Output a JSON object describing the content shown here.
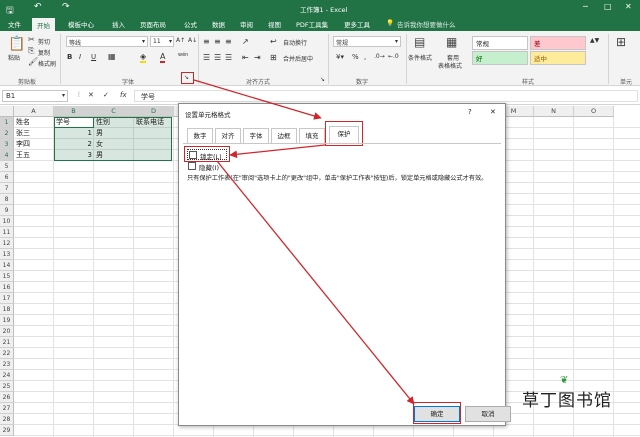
{
  "titlebar": {
    "title": "工作簿1 - Excel",
    "search": "告诉我你想要做什么"
  },
  "tabs": [
    "文件",
    "开始",
    "模板中心",
    "插入",
    "页面布局",
    "公式",
    "数据",
    "审阅",
    "视图",
    "PDF工具集",
    "更多工具"
  ],
  "ribbon": {
    "paste": "粘贴",
    "cut": "剪切",
    "copy": "复制",
    "format_painter": "格式刷",
    "clipboard": "剪贴板",
    "font_name": "等线",
    "font_size": "11",
    "bold": "B",
    "italic": "I",
    "underline": "U",
    "wen": "wén",
    "font_group": "字体",
    "wrap_text": "自动换行",
    "merge_center": "合并后居中",
    "align_group": "对齐方式",
    "number_format": "常规",
    "number_group": "数字",
    "cond_format": "条件格式",
    "table_format_1": "套用",
    "table_format_2": "表格格式",
    "style_normal": "常规",
    "style_bad": "差",
    "style_good": "好",
    "style_neutral": "适中",
    "style_group": "样式",
    "cell_group": "单元"
  },
  "formula_bar": {
    "name_box": "B1",
    "x": "✕",
    "check": "✓",
    "fx": "fx",
    "value": "学号"
  },
  "columns": [
    "A",
    "B",
    "C",
    "D",
    "E",
    "F",
    "G",
    "H",
    "I",
    "J",
    "K",
    "L",
    "M",
    "N",
    "O"
  ],
  "rows": [
    "1",
    "2",
    "3",
    "4",
    "5",
    "6",
    "7",
    "8",
    "9",
    "10",
    "11",
    "12",
    "13",
    "14",
    "15",
    "16",
    "17",
    "18",
    "19",
    "20",
    "21",
    "22",
    "23",
    "24",
    "25",
    "26",
    "27",
    "28",
    "29"
  ],
  "cells": [
    [
      "姓名",
      "学号",
      "性别",
      "联系电话"
    ],
    [
      "张三",
      "1",
      "男",
      ""
    ],
    [
      "李四",
      "2",
      "女",
      ""
    ],
    [
      "王五",
      "3",
      "男",
      ""
    ]
  ],
  "dialog": {
    "title": "设置单元格格式",
    "help": "?",
    "close": "✕",
    "tabs": [
      "数字",
      "对齐",
      "字体",
      "边框",
      "填充",
      "保护"
    ],
    "locked": "锁定(L)",
    "hidden": "隐藏(I)",
    "note": "只有保护工作表(在\"审阅\"选项卡上的\"更改\"组中，单击\"保护工作表\"按钮)后，锁定单元格或隐藏公式才有效。",
    "ok": "确定",
    "cancel": "取消"
  },
  "watermark": "草丁图书馆",
  "colors": {
    "accent": "#217346",
    "annotation": "#d0262b"
  }
}
